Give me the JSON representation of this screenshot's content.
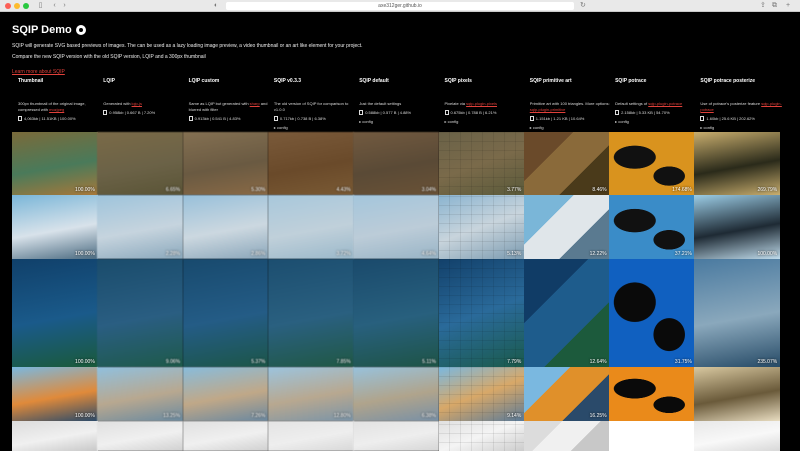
{
  "browser": {
    "url": "axe312ger.github.io"
  },
  "page": {
    "title": "SQIP Demo",
    "description": "SQIP will generate SVG based previews of images. The can be used as a lazy loading image preview, a video thumbnail or an art like element for your project.",
    "compare_text": "Compare the new SQIP version with the old SQIP version, LQIP and a 300px thumbnail",
    "learn_more": "Learn more about SQIP"
  },
  "columns": [
    {
      "name": "Thumbnail",
      "desc": "300px thumbnail of the original image, compressed with mozjpeg",
      "link": "mozjpeg",
      "stats": "4,063kb | 11.51KB | 100.00%",
      "config": ""
    },
    {
      "name": "LQIP",
      "desc": "Generated with lqip-js",
      "link": "lqip-js",
      "stats": "0.958kb | 0.667 B | 7.20%",
      "config": ""
    },
    {
      "name": "LQIP custom",
      "desc": "Same as LQIP but generated with sharp and blurred with filter",
      "link": "sharp",
      "stats": "0.913kb | 0.541 B | 4.83%",
      "config": ""
    },
    {
      "name": "SQIP v0.3.3",
      "desc": "The old version of SQIP for comparison to v1.0.0",
      "link": "",
      "stats": "0.717kb | 0.738 B | 6.38%",
      "config": "config"
    },
    {
      "name": "SQIP default",
      "desc": "Just the default settings",
      "link": "",
      "stats": "0.588kb | 0.577 B | 4.88%",
      "config": "config"
    },
    {
      "name": "SQIP pixels",
      "desc": "Pixelate via sqip-plugin-pixels",
      "link": "sqip-plugin-pixels",
      "stats": "0.675kb | 0.788 B | 6.21%",
      "config": "config"
    },
    {
      "name": "SQIP primitive art",
      "desc": "Primitive art with 100 triangles. More options: sqip-plugin-primitive",
      "link": "sqip-plugin-primitive",
      "stats": "1.151kb | 1.21 KB | 10.64%",
      "config": "config"
    },
    {
      "name": "SQIP potrace",
      "desc": "Default settings of sqip-plugin-potrace",
      "link": "sqip-plugin-potrace",
      "stats": "2.158kb | 5.33 KB | 54.70%",
      "config": "config"
    },
    {
      "name": "SQIP potrace posterize",
      "desc": "Use of potrace's posterize feature sqip-plugin-potrace",
      "link": "sqip-plugin-potrace",
      "stats": "1.60kb | 25.6 KB | 202.62%",
      "config": "config"
    }
  ],
  "rows": [
    {
      "pct": [
        "100.00%",
        "6.65%",
        "5.30%",
        "4.43%",
        "3.04%",
        "3.77%",
        "8.46%",
        "174.68%",
        "269.79%"
      ],
      "colors": [
        [
          "#7a6a3a",
          "#4a7a5a",
          "#a8783a"
        ],
        [
          "#7a6a48",
          "#6b6247",
          "#5a5436"
        ],
        [
          "#847052",
          "#6a5a42",
          "#8a6a46"
        ],
        [
          "#7a5a3a",
          "#6a4a2a",
          "#7a5a34"
        ],
        [
          "#725a40",
          "#5a4a36",
          "#6a5236"
        ],
        [
          "#6a6248",
          "#7a6a4a",
          "#5a5a3a"
        ],
        [
          "#6a4a2a",
          "#8a6a3a",
          "#4a3a1a"
        ],
        [
          "#d9931e",
          "#111111",
          "#d9931e"
        ],
        [
          "#c9ae6e",
          "#2a2a1a",
          "#c9ae6e"
        ]
      ]
    },
    {
      "pct": [
        "100.00%",
        "2.28%",
        "2.86%",
        "3.72%",
        "4.64%",
        "5.13%",
        "12.22%",
        "37.21%",
        "100.00%"
      ],
      "colors": [
        [
          "#7ab6d8",
          "#d8e2ea",
          "#4a6a80"
        ],
        [
          "#9ec4dc",
          "#c6d4de",
          "#8aa8bc"
        ],
        [
          "#98c0da",
          "#ccd8e0",
          "#8aa6ba"
        ],
        [
          "#a8c8dc",
          "#c0d0da",
          "#9ab8ca"
        ],
        [
          "#a4c6dc",
          "#bcccd8",
          "#98b4c6"
        ],
        [
          "#8ab4d0",
          "#c8d4dc",
          "#7a9ab0"
        ],
        [
          "#7ab6d8",
          "#e0e6ea",
          "#5a7a90"
        ],
        [
          "#3a8cc8",
          "#111111",
          "#ffffff"
        ],
        [
          "#9ccde6",
          "#1e2a34",
          "#c0dcec"
        ]
      ]
    },
    {
      "pct": [
        "100.00%",
        "9.06%",
        "5.37%",
        "7.85%",
        "5.11%",
        "7.79%",
        "12.64%",
        "31.75%",
        "235.07%"
      ],
      "colors": [
        [
          "#10406a",
          "#1a5a8a",
          "#1a5a3a"
        ],
        [
          "#1a4c6c",
          "#2a5e82",
          "#1e5a4a"
        ],
        [
          "#184a6e",
          "#245c86",
          "#1c5648"
        ],
        [
          "#1c4e70",
          "#2a6080",
          "#205844"
        ],
        [
          "#1a4a6c",
          "#28607e",
          "#1e5446"
        ],
        [
          "#12406a",
          "#2a6a9a",
          "#1a5a4a"
        ],
        [
          "#103c66",
          "#1e5c8c",
          "#1c5a3c"
        ],
        [
          "#1060c0",
          "#0a0a0a",
          "#1060c0"
        ],
        [
          "#4a7aa0",
          "#8aa8bc",
          "#264a66"
        ]
      ]
    },
    {
      "pct": [
        "100.00%",
        "13.25%",
        "7.26%",
        "12.80%",
        "6.38%",
        "9.14%",
        "16.25%",
        "",
        ""
      ],
      "colors": [
        [
          "#7ab8e0",
          "#e08a3a",
          "#2a4a6a"
        ],
        [
          "#90c0de",
          "#b8a890",
          "#6a8aa0"
        ],
        [
          "#88bcdc",
          "#c0a888",
          "#6a88a0"
        ],
        [
          "#9cc4de",
          "#b8a890",
          "#7a94a8"
        ],
        [
          "#98c2dc",
          "#b0a48c",
          "#7890a6"
        ],
        [
          "#7ab8e0",
          "#d8a868",
          "#5a7a98"
        ],
        [
          "#7ab8e0",
          "#e0902a",
          "#2a4a6a"
        ],
        [
          "#ea8a1a",
          "#0a0a0a",
          "#ffffff"
        ],
        [
          "#d8c8a0",
          "#6a5a3a",
          "#e8dcc0"
        ]
      ]
    },
    {
      "pct": [
        "",
        "",
        "",
        "",
        "",
        "",
        "",
        "",
        ""
      ],
      "colors": [
        [
          "#dcdcdc",
          "#f0f0f0",
          "#c8c8c8"
        ],
        [
          "#e0e0e0",
          "#f0f0f0",
          "#d0d0d0"
        ],
        [
          "#e0e0e0",
          "#f0f0f0",
          "#d0d0d0"
        ],
        [
          "#e4e4e4",
          "#eeeeee",
          "#d8d8d8"
        ],
        [
          "#e2e2e2",
          "#eeeeee",
          "#d6d6d6"
        ],
        [
          "#e0e0e0",
          "#f4f4f4",
          "#cccccc"
        ],
        [
          "#dcdcdc",
          "#f0f0f0",
          "#c8c8c8"
        ],
        [
          "#ffffff",
          "#ffffff",
          "#ffffff"
        ],
        [
          "#e8e8e8",
          "#f8f8f8",
          "#d8d8d8"
        ]
      ]
    }
  ]
}
